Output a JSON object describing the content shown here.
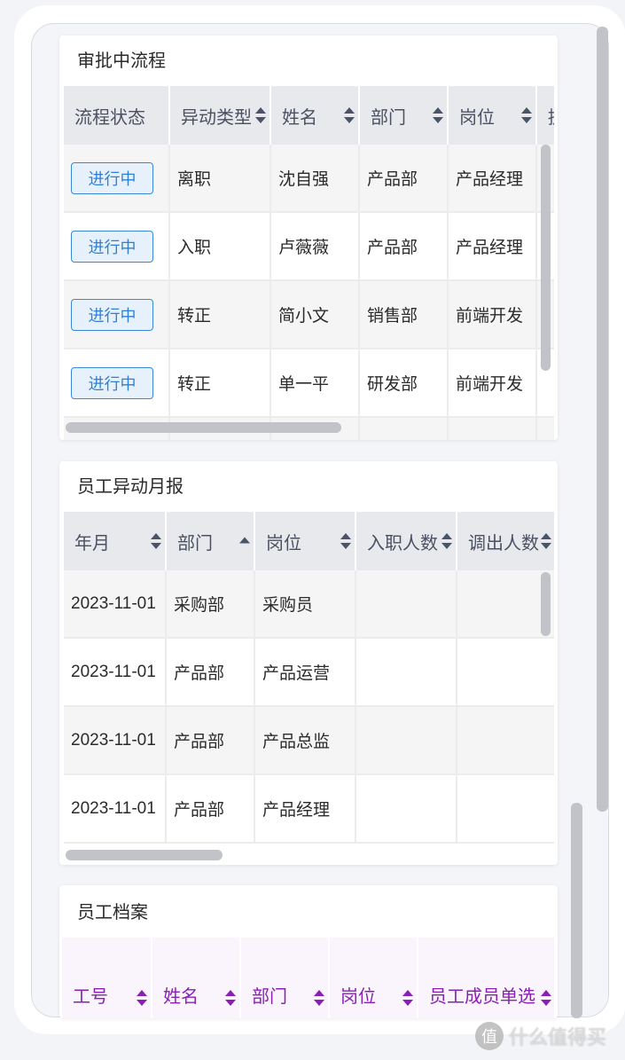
{
  "approval": {
    "title": "审批中流程",
    "headers": [
      "流程状态",
      "异动类型",
      "姓名",
      "部门",
      "岗位",
      "提"
    ],
    "rows": [
      {
        "status": "进行中",
        "type": "离职",
        "name": "沈自强",
        "dept": "产品部",
        "post": "产品经理"
      },
      {
        "status": "进行中",
        "type": "入职",
        "name": "卢薇薇",
        "dept": "产品部",
        "post": "产品经理"
      },
      {
        "status": "进行中",
        "type": "转正",
        "name": "简小文",
        "dept": "销售部",
        "post": "前端开发"
      },
      {
        "status": "进行中",
        "type": "转正",
        "name": "单一平",
        "dept": "研发部",
        "post": "前端开发"
      }
    ]
  },
  "monthly": {
    "title": "员工异动月报",
    "headers": [
      "年月",
      "部门",
      "岗位",
      "入职人数",
      "调出人数"
    ],
    "rows": [
      {
        "month": "2023-11-01",
        "dept": "采购部",
        "post": "采购员"
      },
      {
        "month": "2023-11-01",
        "dept": "产品部",
        "post": "产品运营"
      },
      {
        "month": "2023-11-01",
        "dept": "产品部",
        "post": "产品总监"
      },
      {
        "month": "2023-11-01",
        "dept": "产品部",
        "post": "产品经理"
      }
    ]
  },
  "archive": {
    "title": "员工档案",
    "headers": [
      "工号",
      "姓名",
      "部门",
      "岗位",
      "员工成员单选"
    ]
  },
  "watermark": {
    "badge": "值",
    "text": "什么值得买"
  },
  "colors": {
    "status_border": "#3a86d8",
    "status_bg": "#e6f1fc",
    "purple_header_text": "#8a1fb3",
    "header_bg": "#e8e9ec"
  }
}
